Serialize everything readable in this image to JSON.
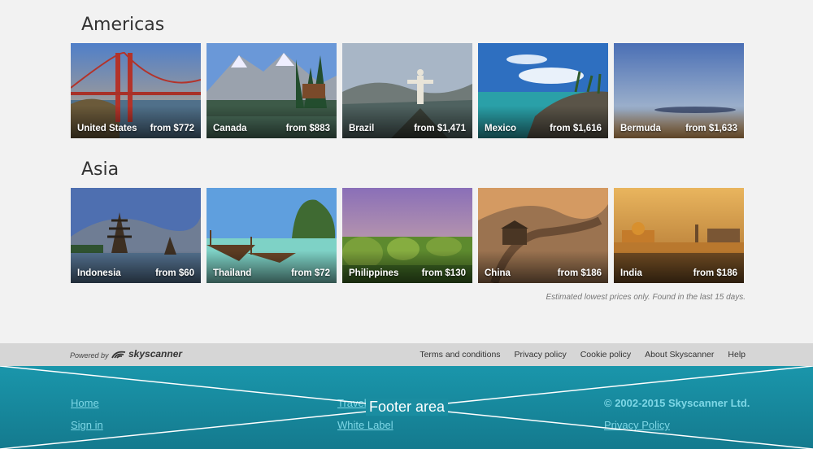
{
  "sections": [
    {
      "title": "Americas",
      "cards": [
        {
          "name": "United States",
          "price": "from $772"
        },
        {
          "name": "Canada",
          "price": "from $883"
        },
        {
          "name": "Brazil",
          "price": "from $1,471"
        },
        {
          "name": "Mexico",
          "price": "from $1,616"
        },
        {
          "name": "Bermuda",
          "price": "from $1,633"
        }
      ]
    },
    {
      "title": "Asia",
      "cards": [
        {
          "name": "Indonesia",
          "price": "from $60"
        },
        {
          "name": "Thailand",
          "price": "from $72"
        },
        {
          "name": "Philippines",
          "price": "from $130"
        },
        {
          "name": "China",
          "price": "from $186"
        },
        {
          "name": "India",
          "price": "from $186"
        }
      ]
    }
  ],
  "disclaimer": "Estimated lowest prices only. Found in the last 15 days.",
  "powered": {
    "label": "Powered by",
    "logo_text": "skyscanner"
  },
  "legal_links": [
    "Terms and conditions",
    "Privacy policy",
    "Cookie policy",
    "About Skyscanner",
    "Help"
  ],
  "footer": {
    "label": "Footer area",
    "col1": [
      "Home",
      "Sign in"
    ],
    "col2": [
      "Travel Tips",
      "White Label"
    ],
    "copyright": "© 2002-2015 Skyscanner Ltd.",
    "col3": [
      "Privacy Policy"
    ]
  },
  "colors": {
    "footer_bg": "#1a96ab",
    "footer_link": "#7ed7e6",
    "powered_bar": "#d6d6d6"
  }
}
